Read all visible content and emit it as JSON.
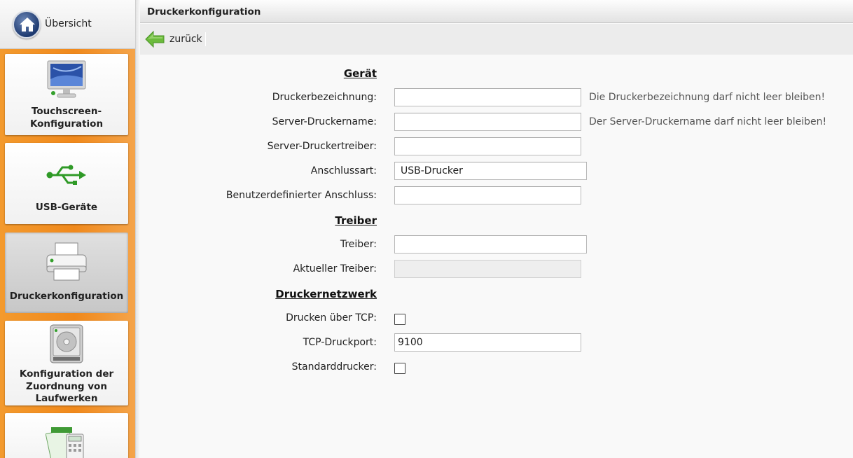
{
  "sidebar": {
    "home_label": "Übersicht",
    "items": [
      {
        "label": "Touchscreen-\nKonfiguration",
        "icon": "monitor-icon"
      },
      {
        "label": "USB-Geräte",
        "icon": "usb-icon"
      },
      {
        "label": "Druckerkonfiguration",
        "icon": "printer-icon",
        "active": true
      },
      {
        "label": "Konfiguration der\nZuordnung von\nLaufwerken",
        "icon": "drive-icon"
      },
      {
        "label": "",
        "icon": "spreadsheet-icon"
      }
    ]
  },
  "header": {
    "title": "Druckerkonfiguration"
  },
  "toolbar": {
    "back_label": "zurück"
  },
  "form": {
    "sections": {
      "device": "Gerät",
      "driver": "Treiber",
      "network": "Druckernetzwerk"
    },
    "fields": {
      "printer_name": {
        "label": "Druckerbezeichnung:",
        "value": "",
        "hint": "Die Druckerbezeichnung darf nicht leer bleiben!"
      },
      "server_printer_name": {
        "label": "Server-Druckername:",
        "value": "",
        "hint": "Der Server-Druckername darf nicht leer bleiben!"
      },
      "server_printer_driver": {
        "label": "Server-Druckertreiber:",
        "value": ""
      },
      "connection_type": {
        "label": "Anschlussart:",
        "value": "USB-Drucker"
      },
      "custom_connection": {
        "label": "Benutzerdefinierter Anschluss:",
        "value": ""
      },
      "driver": {
        "label": "Treiber:",
        "value": ""
      },
      "current_driver": {
        "label": "Aktueller Treiber:",
        "value": ""
      },
      "print_tcp": {
        "label": "Drucken über TCP:",
        "checked": false
      },
      "tcp_port": {
        "label": "TCP-Druckport:",
        "value": "9100"
      },
      "default_printer": {
        "label": "Standarddrucker:",
        "checked": false
      }
    }
  }
}
